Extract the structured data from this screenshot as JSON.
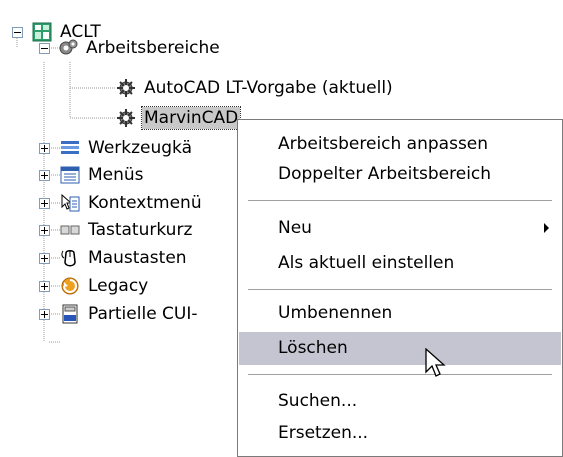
{
  "tree": {
    "root": {
      "label": "ACLT",
      "icon": "customize-root-icon"
    },
    "workspaces": {
      "label": "Arbeitsbereiche",
      "icon": "gears-icon",
      "children": [
        {
          "label": "AutoCAD LT-Vorgabe (aktuell)",
          "icon": "gear-icon"
        },
        {
          "label": "MarvinCAD",
          "icon": "gear-icon",
          "selected": true
        }
      ]
    },
    "items": [
      {
        "label": "Werkzeugkä",
        "icon": "toolbar-icon"
      },
      {
        "label": "Menüs",
        "icon": "menu-icon"
      },
      {
        "label": "Kontextmenü",
        "icon": "context-menu-icon"
      },
      {
        "label": "Tastaturkurz",
        "icon": "keyboard-icon"
      },
      {
        "label": "Maustasten",
        "icon": "mouse-icon"
      },
      {
        "label": "Legacy",
        "icon": "legacy-icon"
      },
      {
        "label": "Partielle CUI-",
        "icon": "partial-cui-icon"
      }
    ]
  },
  "context_menu": {
    "groups": [
      [
        {
          "label": "Arbeitsbereich anpassen"
        },
        {
          "label": "Doppelter Arbeitsbereich"
        }
      ],
      [
        {
          "label": "Neu",
          "submenu": true
        },
        {
          "label": "Als aktuell einstellen"
        }
      ],
      [
        {
          "label": "Umbenennen"
        },
        {
          "label": "Löschen",
          "highlighted": true
        }
      ],
      [
        {
          "label": "Suchen..."
        },
        {
          "label": "Ersetzen..."
        }
      ]
    ]
  },
  "colors": {
    "highlight": "#c5c5d2",
    "selection": "#c9c9c9",
    "border": "#7a7a7a"
  }
}
